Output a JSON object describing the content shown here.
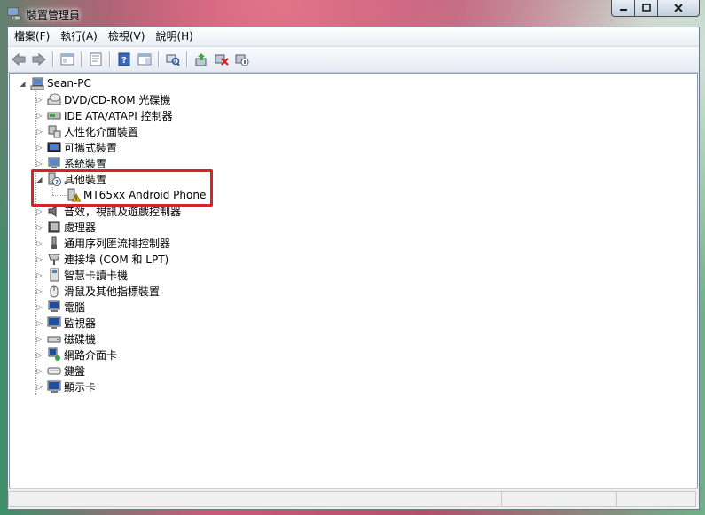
{
  "window": {
    "title": "裝置管理員"
  },
  "menu": [
    {
      "label": "檔案(F)"
    },
    {
      "label": "執行(A)"
    },
    {
      "label": "檢視(V)"
    },
    {
      "label": "說明(H)"
    }
  ],
  "toolbar": {
    "buttons": [
      "back-icon",
      "forward-icon",
      "show-hide-tree-icon",
      "properties-icon",
      "help-icon",
      "action-pane-icon",
      "scan-hardware-icon",
      "update-driver-icon",
      "uninstall-icon",
      "disable-icon"
    ]
  },
  "tree": {
    "root": "Sean-PC",
    "items": [
      {
        "label": "DVD/CD-ROM 光碟機",
        "icon": "cdrom-icon"
      },
      {
        "label": "IDE ATA/ATAPI 控制器",
        "icon": "ide-controller-icon"
      },
      {
        "label": "人性化介面裝置",
        "icon": "hid-icon"
      },
      {
        "label": "可攜式裝置",
        "icon": "portable-device-icon"
      },
      {
        "label": "系統裝置",
        "icon": "system-device-icon"
      },
      {
        "label": "其他裝置",
        "icon": "other-device-icon",
        "expanded": true,
        "children": [
          {
            "label": "MT65xx Android Phone",
            "icon": "warning-device-icon"
          }
        ]
      },
      {
        "label": "音效，視訊及遊戲控制器",
        "icon": "sound-icon"
      },
      {
        "label": "處理器",
        "icon": "processor-icon"
      },
      {
        "label": "通用序列匯流排控制器",
        "icon": "usb-icon"
      },
      {
        "label": "連接埠 (COM 和 LPT)",
        "icon": "port-icon"
      },
      {
        "label": "智慧卡讀卡機",
        "icon": "smartcard-icon"
      },
      {
        "label": "滑鼠及其他指標裝置",
        "icon": "mouse-icon"
      },
      {
        "label": "電腦",
        "icon": "computer-icon"
      },
      {
        "label": "監視器",
        "icon": "monitor-icon"
      },
      {
        "label": "磁碟機",
        "icon": "disk-icon"
      },
      {
        "label": "網路介面卡",
        "icon": "network-icon"
      },
      {
        "label": "鍵盤",
        "icon": "keyboard-icon"
      },
      {
        "label": "顯示卡",
        "icon": "display-adapter-icon"
      }
    ]
  },
  "colors": {
    "highlight": "#d8222a",
    "accent": "#1f4e9a"
  }
}
